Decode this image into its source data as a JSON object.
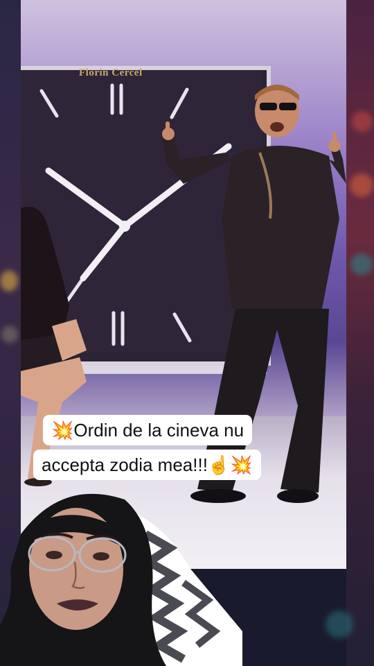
{
  "video": {
    "brand_text": "Florin Cercel"
  },
  "caption": {
    "line1": "💥Ordin de la cineva nu",
    "line2": "accepta zodia mea!!!☝️💥"
  },
  "colors": {
    "caption_bg": "#ffffff",
    "caption_text": "#111111",
    "background": "#1a1a2e"
  }
}
